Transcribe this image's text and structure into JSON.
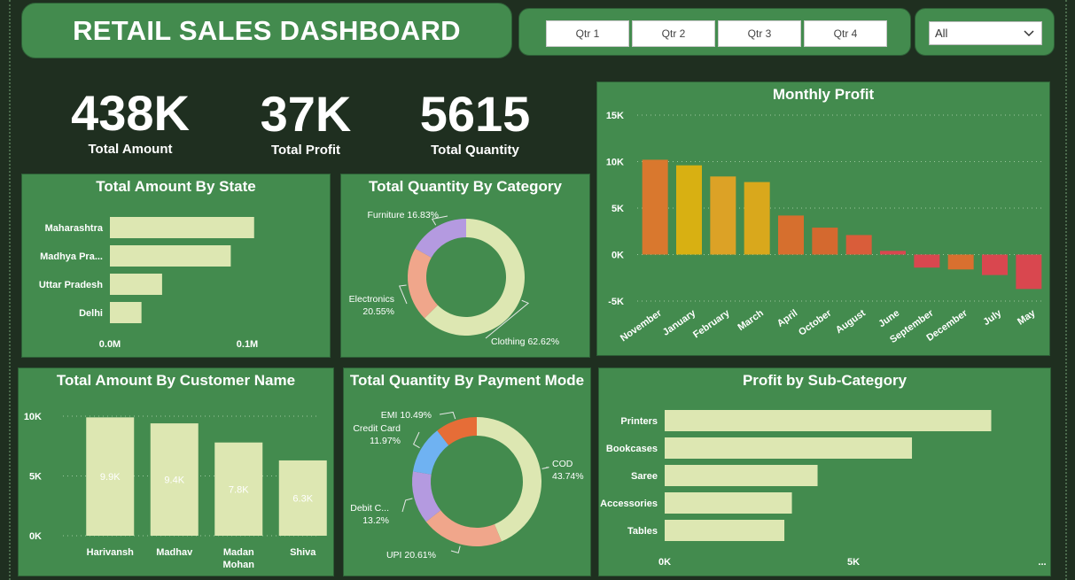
{
  "header": {
    "title": "RETAIL SALES DASHBOARD"
  },
  "slicers": {
    "quarters": [
      "Qtr 1",
      "Qtr 2",
      "Qtr 3",
      "Qtr 4"
    ],
    "dropdown_value": "All"
  },
  "kpis": [
    {
      "value": "438K",
      "label": "Total Amount"
    },
    {
      "value": "37K",
      "label": "Total Profit"
    },
    {
      "value": "5615",
      "label": "Total Quantity"
    }
  ],
  "colors": {
    "panel": "#438b4e",
    "background": "#1f2f20",
    "bar": "#dde7b2",
    "negative": "#d94f52"
  },
  "chart_data": [
    {
      "id": "state",
      "type": "bar",
      "orientation": "horizontal",
      "title": "Total Amount By State",
      "categories": [
        "Maharashtra",
        "Madhya Pra...",
        "Uttar Pradesh",
        "Delhi"
      ],
      "values": [
        0.105,
        0.088,
        0.038,
        0.023
      ],
      "xlim": [
        0,
        0.1
      ],
      "ticks": [
        "0.0M",
        "0.1M"
      ]
    },
    {
      "id": "category",
      "type": "pie",
      "donut": true,
      "title": "Total Quantity By Category",
      "slices": [
        {
          "label": "Clothing",
          "pct": "62.62%",
          "value": 62.62,
          "color": "#dde7b2"
        },
        {
          "label": "Electronics",
          "pct": "20.55%",
          "value": 20.55,
          "color": "#f0a68b"
        },
        {
          "label": "Furniture",
          "pct": "16.83%",
          "value": 16.83,
          "color": "#b49ae0"
        }
      ]
    },
    {
      "id": "monthly",
      "type": "bar",
      "title": "Monthly Profit",
      "categories": [
        "November",
        "January",
        "February",
        "March",
        "April",
        "October",
        "August",
        "June",
        "September",
        "December",
        "July",
        "May"
      ],
      "values": [
        10200,
        9600,
        8400,
        7800,
        4200,
        2900,
        2100,
        400,
        -1400,
        -1600,
        -2200,
        -3700
      ],
      "colors": [
        "#d9782e",
        "#d8b012",
        "#dca226",
        "#d9a81c",
        "#d66f2e",
        "#d4692f",
        "#d95d3a",
        "#d9474f",
        "#d9474f",
        "#d9702f",
        "#d9474f",
        "#d9474f"
      ],
      "ylim": [
        -5000,
        15000
      ],
      "ticks": [
        "-5K",
        "0K",
        "5K",
        "10K",
        "15K"
      ],
      "tick_values": [
        -5000,
        0,
        5000,
        10000,
        15000
      ]
    },
    {
      "id": "customer",
      "type": "bar",
      "title": "Total Amount By Customer Name",
      "categories": [
        "Harivansh",
        "Madhav",
        "Madan Mohan",
        "Shiva"
      ],
      "category_lines": [
        [
          "Harivansh"
        ],
        [
          "Madhav"
        ],
        [
          "Madan",
          "Mohan"
        ],
        [
          "Shiva"
        ]
      ],
      "values": [
        9900,
        9400,
        7800,
        6300
      ],
      "data_labels": [
        "9.9K",
        "9.4K",
        "7.8K",
        "6.3K"
      ],
      "ylim": [
        0,
        10000
      ],
      "ticks": [
        "0K",
        "5K",
        "10K"
      ],
      "tick_values": [
        0,
        5000,
        10000
      ]
    },
    {
      "id": "payment",
      "type": "pie",
      "donut": true,
      "title": "Total Quantity By Payment Mode",
      "slices": [
        {
          "label": "COD",
          "pct": "43.74%",
          "value": 43.74,
          "color": "#dde7b2"
        },
        {
          "label": "UPI",
          "pct": "20.61%",
          "value": 20.61,
          "color": "#f0a68b"
        },
        {
          "label": "Debit C...",
          "pct": "13.2%",
          "value": 13.2,
          "color": "#b49ae0"
        },
        {
          "label": "Credit Card",
          "pct": "11.97%",
          "value": 11.97,
          "color": "#6fb2f2"
        },
        {
          "label": "EMI",
          "pct": "10.49%",
          "value": 10.49,
          "color": "#e66d37"
        }
      ]
    },
    {
      "id": "subcat",
      "type": "bar",
      "orientation": "horizontal",
      "title": "Profit by Sub-Category",
      "categories": [
        "Printers",
        "Bookcases",
        "Saree",
        "Accessories",
        "Tables"
      ],
      "values": [
        8650,
        6550,
        4050,
        3370,
        3170
      ],
      "xlim": [
        0,
        5000
      ],
      "ticks": [
        "0K",
        "5K",
        "..."
      ]
    }
  ]
}
